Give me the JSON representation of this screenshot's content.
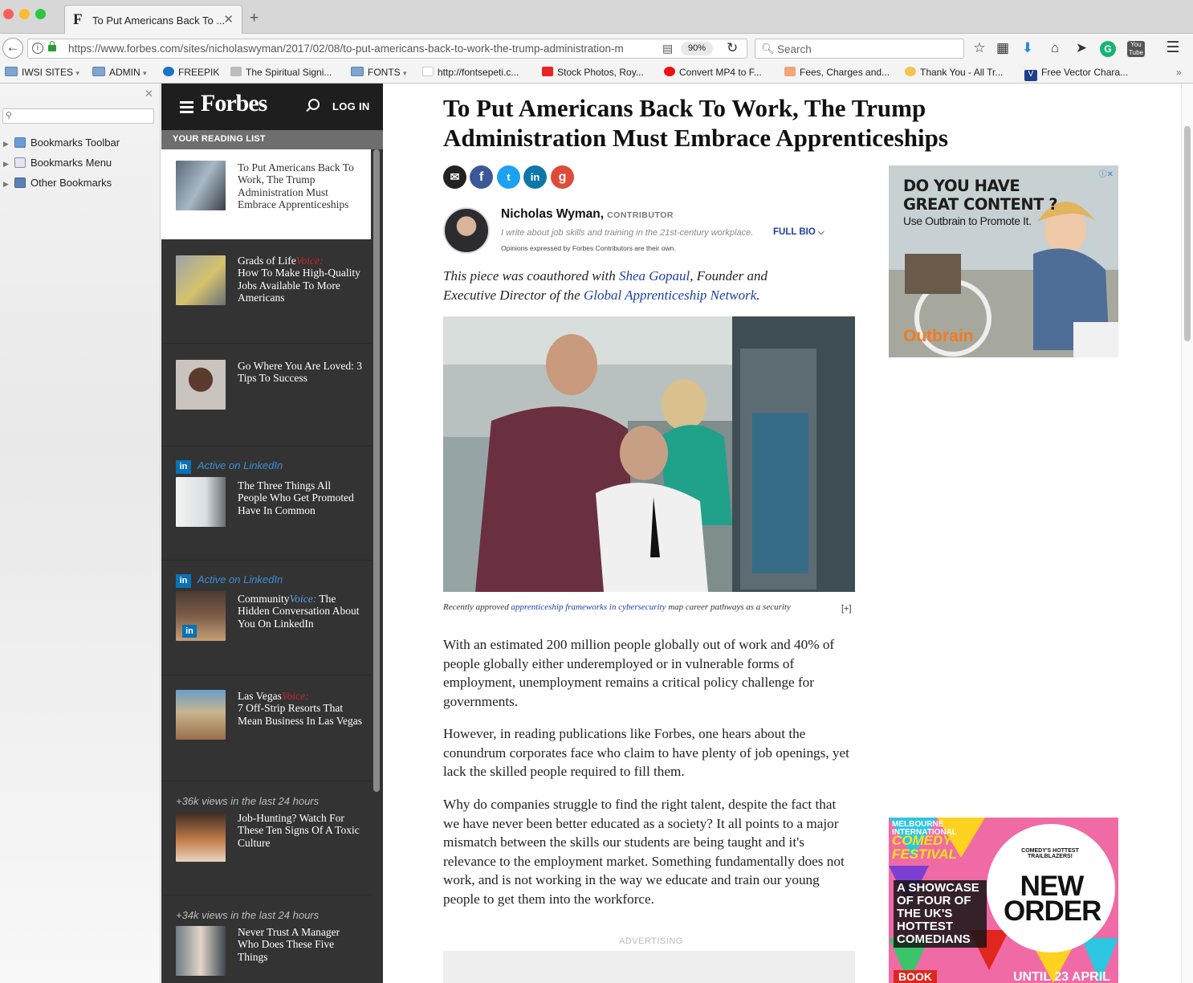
{
  "browser": {
    "tab_title": "To Put Americans Back To ...",
    "tab_favicon": "F",
    "url": "https://www.forbes.com/sites/nicholaswyman/2017/02/08/to-put-americans-back-to-work-the-trump-administration-m",
    "zoom": "90%",
    "search_placeholder": "Search",
    "toolbar_icons": [
      "bookmark-star-icon",
      "reading-list-icon",
      "download-icon",
      "home-icon",
      "send-icon",
      "grammarly-icon",
      "youtube-icon",
      "menu-icon"
    ]
  },
  "bookmarks_bar": [
    {
      "label": "IWSI SITES",
      "dropdown": "▾"
    },
    {
      "label": "ADMIN",
      "dropdown": "▾"
    },
    {
      "label": "FREEPIK"
    },
    {
      "label": "The Spiritual Signi..."
    },
    {
      "label": "FONTS",
      "dropdown": "▾"
    },
    {
      "label": "http://fontsepeti.c..."
    },
    {
      "label": "Stock Photos, Roy..."
    },
    {
      "label": "Convert MP4 to F..."
    },
    {
      "label": "Fees, Charges and..."
    },
    {
      "label": "Thank You - All Tr..."
    },
    {
      "label": "Free Vector Chara..."
    }
  ],
  "sidebar": {
    "items": [
      "Bookmarks Toolbar",
      "Bookmarks Menu",
      "Other Bookmarks"
    ]
  },
  "forbes": {
    "logo": "Forbes",
    "login": "LOG IN",
    "reading_list_label": "YOUR READING LIST",
    "items": [
      {
        "title": "To Put Americans Back To Work, The Trump Administration Must Embrace Apprenticeships"
      },
      {
        "brand": "Grads of Life",
        "voice": "Voice:",
        "title": "How To Make High-Quality Jobs Available To More Americans"
      },
      {
        "title": "Go Where You Are Loved: 3 Tips To Success"
      },
      {
        "tag": "Active on LinkedIn",
        "title": "The Three Things All People Who Get Promoted Have In Common"
      },
      {
        "tag": "Active on LinkedIn",
        "brand": "Community",
        "voice": "Voice:",
        "title": "The Hidden Conversation About You On LinkedIn"
      },
      {
        "brand": "Las Vegas",
        "voice": "Voice:",
        "title": "7 Off-Strip Resorts That Mean Business In Las Vegas"
      },
      {
        "tag": "+36k views in the last 24 hours",
        "title": "Job-Hunting? Watch For These Ten Signs Of A Toxic Culture"
      },
      {
        "tag": "+34k views in the last 24 hours",
        "title": "Never Trust A Manager Who Does These Five Things"
      }
    ]
  },
  "article": {
    "title": "To Put Americans Back To Work, The Trump Administration Must Embrace Apprenticeships",
    "share_icons": [
      "email-icon",
      "facebook-icon",
      "twitter-icon",
      "linkedin-icon",
      "google-plus-icon"
    ],
    "author": "Nicholas Wyman,",
    "author_role": "CONTRIBUTOR",
    "bio": "I write about job skills and training in the 21st-century workplace.",
    "full_bio": "FULL BIO",
    "opinion_note": "Opinions expressed by Forbes Contributors are their own.",
    "intro_a": "This piece was coauthored with ",
    "intro_link1": "Shea Gopaul",
    "intro_b": ", Founder and Executive Director of the ",
    "intro_link2": "Global Apprenticeship Network",
    "intro_c": ".",
    "caption_a": "Recently approved ",
    "caption_link": "apprenticeship frameworks in cybersecurity",
    "caption_b": " map career pathways as a security",
    "caption_expand": "[+]",
    "paragraphs": [
      "With an estimated 200 million people globally out of work and 40% of people globally either underemployed or in vulnerable forms of employment, unemployment remains a critical policy challenge for governments.",
      "However, in reading publications like Forbes, one hears about the conundrum corporates face who claim to have plenty of job openings, yet lack the skilled people required to fill them.",
      "Why do companies struggle to find the right talent, despite the fact that we have never been better educated as a society?  It all points to a major mismatch between the skills our students are being taught and it's relevance to the employment market. Something fundamentally does not work, and is not working in the way we educate and train our young people to get them into the workforce."
    ],
    "advertising_label": "ADVERTISING"
  },
  "ads": {
    "outbrain": {
      "line1": "DO YOU HAVE",
      "line2": "GREAT CONTENT ?",
      "line3": "Use Outbrain to Promote It.",
      "brand": "Outbrain"
    },
    "comedy": {
      "l1": "MELBOURNE",
      "l1b": "INTERNATIONAL",
      "l2": "COMEDY",
      "l2b": "FESTIVAL",
      "l3": "A SHOWCASE OF FOUR OF THE UK'S HOTTEST COMEDIANS",
      "l4": "NEW",
      "l4b": "ORDER",
      "l5": "COMEDY'S HOTTEST TRAILBLAZERS!",
      "l6": "UNTIL 23 APRIL",
      "l7": "BOOK"
    }
  }
}
